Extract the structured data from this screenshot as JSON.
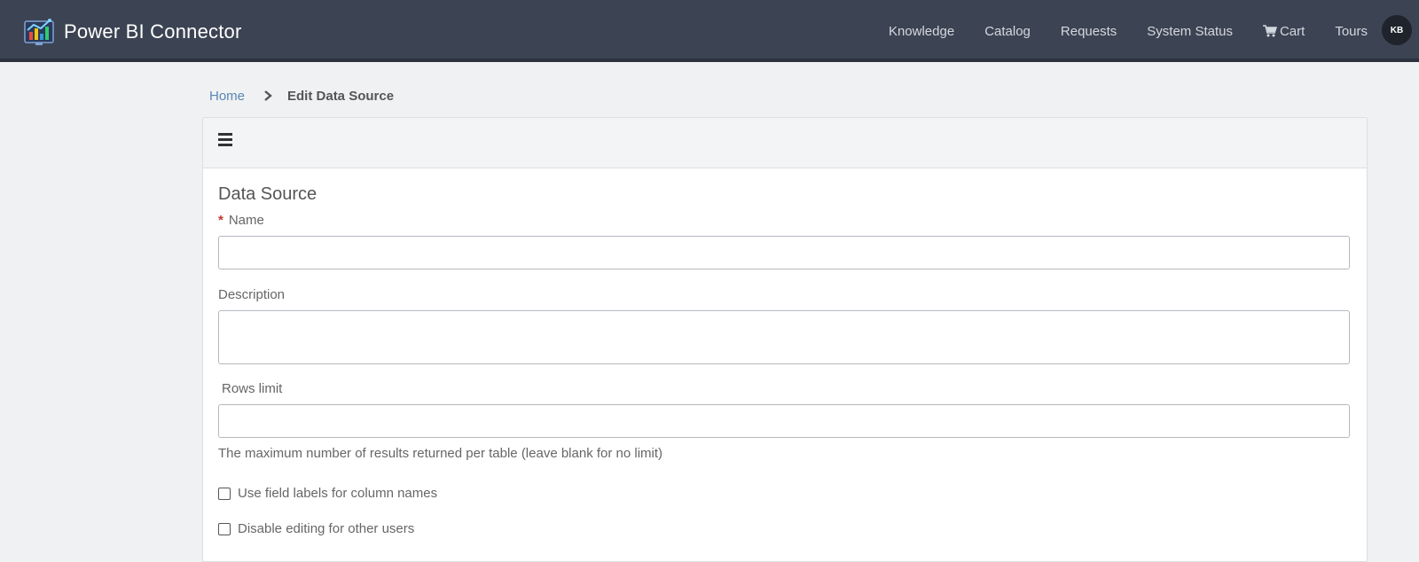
{
  "app": {
    "title": "Power BI Connector"
  },
  "nav": {
    "items": [
      {
        "label": "Knowledge"
      },
      {
        "label": "Catalog"
      },
      {
        "label": "Requests"
      },
      {
        "label": "System Status"
      },
      {
        "label": "Cart",
        "icon": "cart-icon"
      },
      {
        "label": "Tours"
      }
    ],
    "avatar_initials": "KB"
  },
  "breadcrumb": {
    "home": "Home",
    "current": "Edit Data Source"
  },
  "form": {
    "section_title": "Data Source",
    "name_label": "Name",
    "name_value": "",
    "description_label": "Description",
    "description_value": "",
    "rows_limit_label": "Rows limit",
    "rows_limit_value": "",
    "rows_limit_help": "The maximum number of results returned per table (leave blank for no limit)",
    "use_field_labels": {
      "label": "Use field labels for column names",
      "checked": false
    },
    "disable_editing": {
      "label": "Disable editing for other users",
      "checked": false
    }
  },
  "colors": {
    "header_bg": "#3c4352",
    "link": "#5a86b4",
    "required": "#c0392b"
  }
}
